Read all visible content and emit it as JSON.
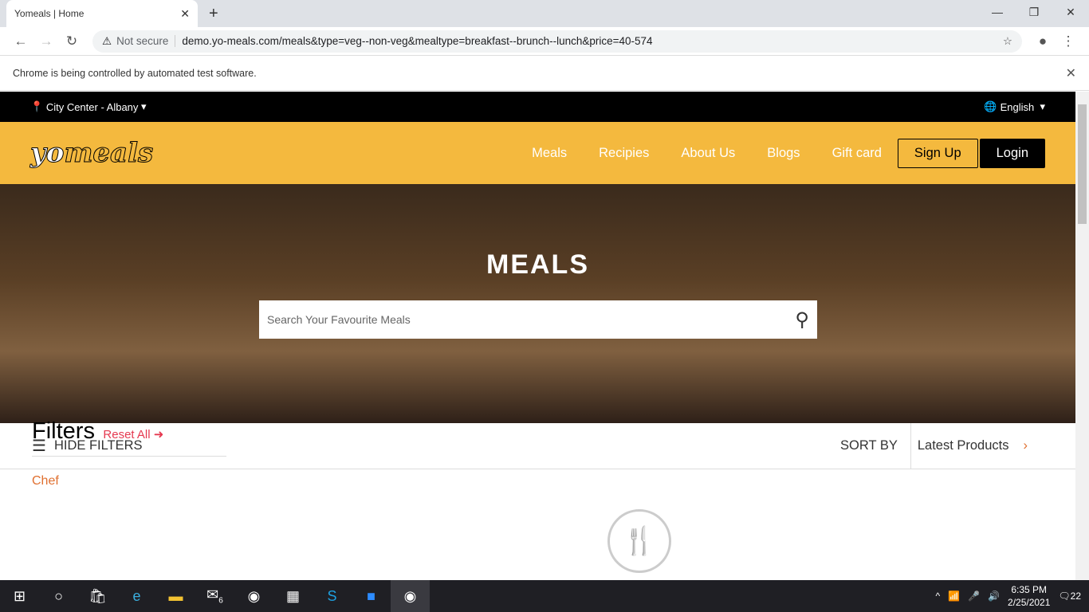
{
  "browser": {
    "tab_title": "Yomeals | Home",
    "security": "Not secure",
    "url": "demo.yo-meals.com/meals&type=veg--non-veg&mealtype=breakfast--brunch--lunch&price=40-574",
    "infobar": "Chrome is being controlled by automated test software."
  },
  "topstrip": {
    "location": "City Center - Albany",
    "language": "English"
  },
  "header": {
    "logo": "yomeals",
    "nav": [
      "Meals",
      "Recipies",
      "About Us",
      "Blogs",
      "Gift card"
    ],
    "signup": "Sign Up",
    "login": "Login"
  },
  "hero": {
    "title": "MEALS",
    "search_placeholder": "Search Your Favourite Meals"
  },
  "filterbar": {
    "hide_filters": "HIDE FILTERS",
    "sort_by": "SORT BY",
    "sort_value": "Latest Products"
  },
  "filters": {
    "title": "Filters",
    "reset": "Reset All",
    "first_group": "Chef"
  },
  "taskbar": {
    "mail_badge": "6",
    "time": "6:35 PM",
    "date": "2/25/2021",
    "notifications": "22"
  },
  "colors": {
    "brand": "#f4b93e",
    "accent": "#e53950"
  }
}
